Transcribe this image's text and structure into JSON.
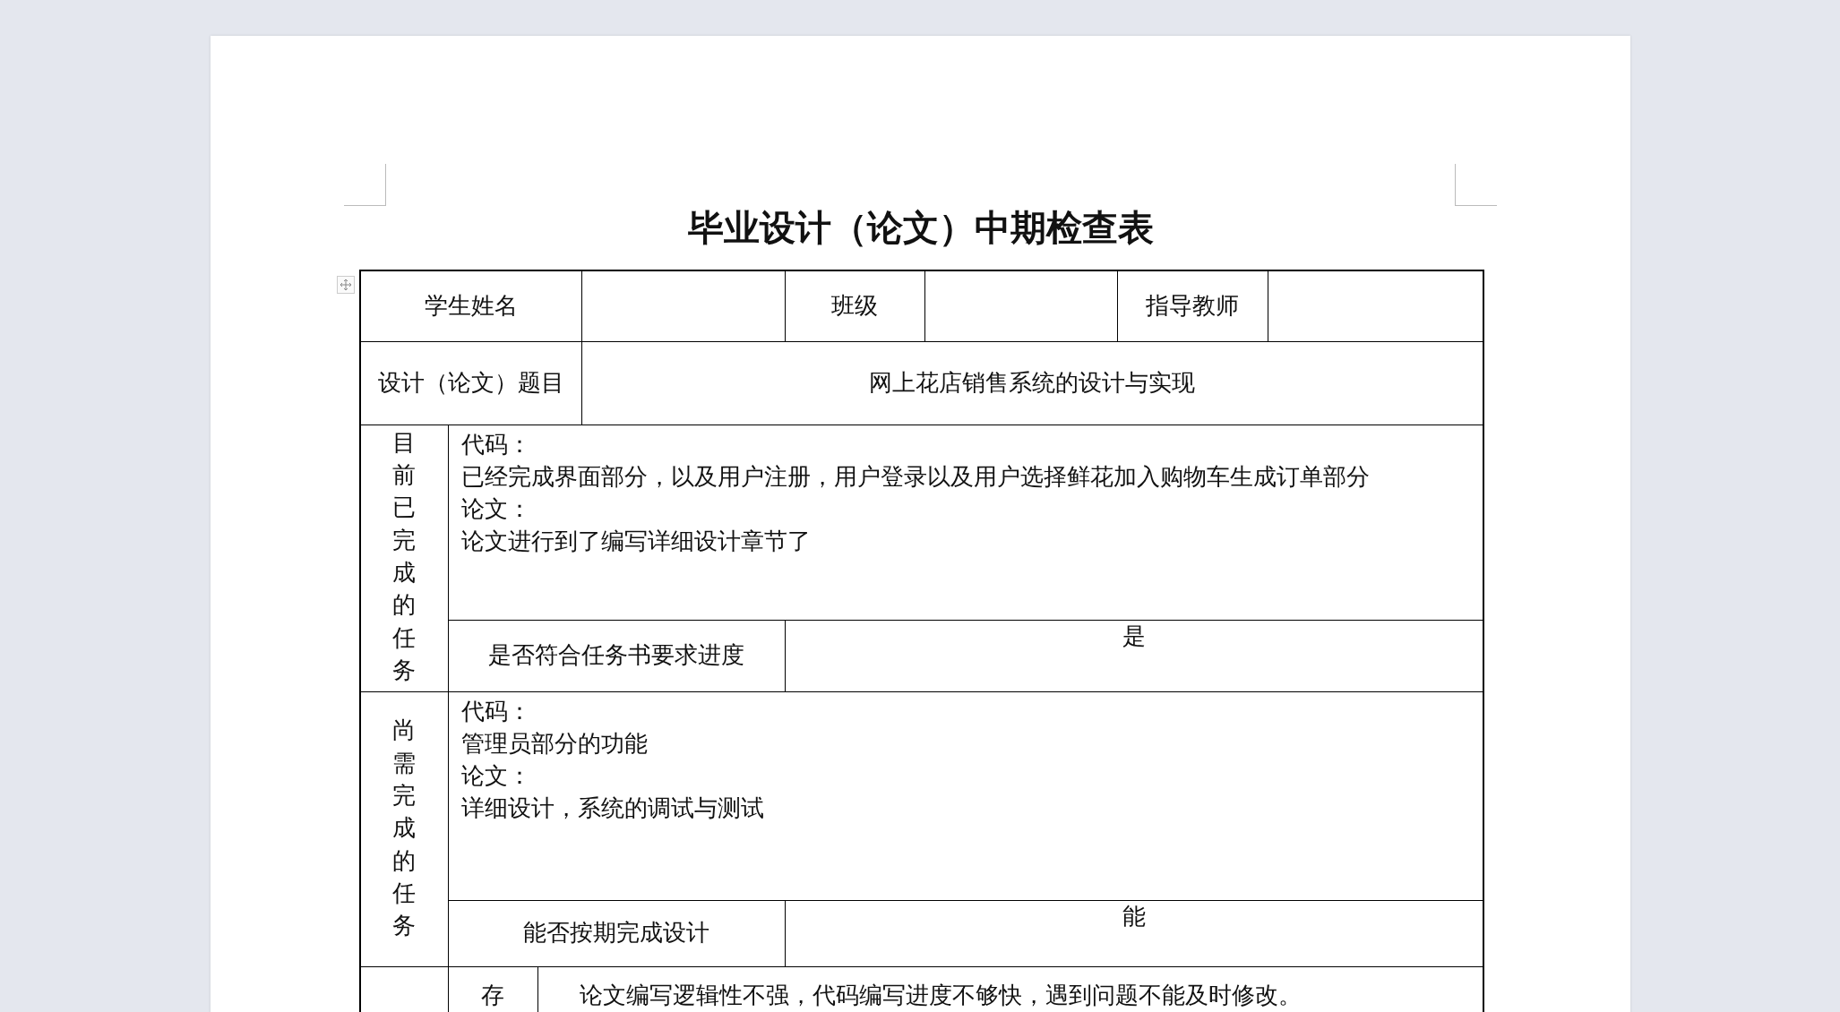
{
  "document": {
    "title": "毕业设计（论文）中期检查表",
    "table": {
      "student_name_label": "学生姓名",
      "class_label": "班级",
      "advisor_label": "指导教师",
      "topic_label": "设计（论文）题目",
      "topic": "网上花店销售系统的设计与实现",
      "sections": [
        {
          "label": "目前已完成的任务",
          "lines": [
            "代码：",
            "已经完成界面部分，以及用户注册，用户登录以及用户选择鲜花加入购物车生成订单部分",
            "论文：",
            "论文进行到了编写详细设计章节了"
          ],
          "question": "是否符合任务书要求进度",
          "answer": "是"
        },
        {
          "label": "尚需完成的任务",
          "lines": [
            "代码：",
            "管理员部分的功能",
            "论文：",
            "详细设计，系统的调试与测试"
          ],
          "question": "能否按期完成设计",
          "answer": "能"
        }
      ],
      "problems": {
        "label": "存",
        "text": "论文编写逻辑性不强，代码编写进度不够快，遇到问题不能及时修改。"
      }
    }
  }
}
